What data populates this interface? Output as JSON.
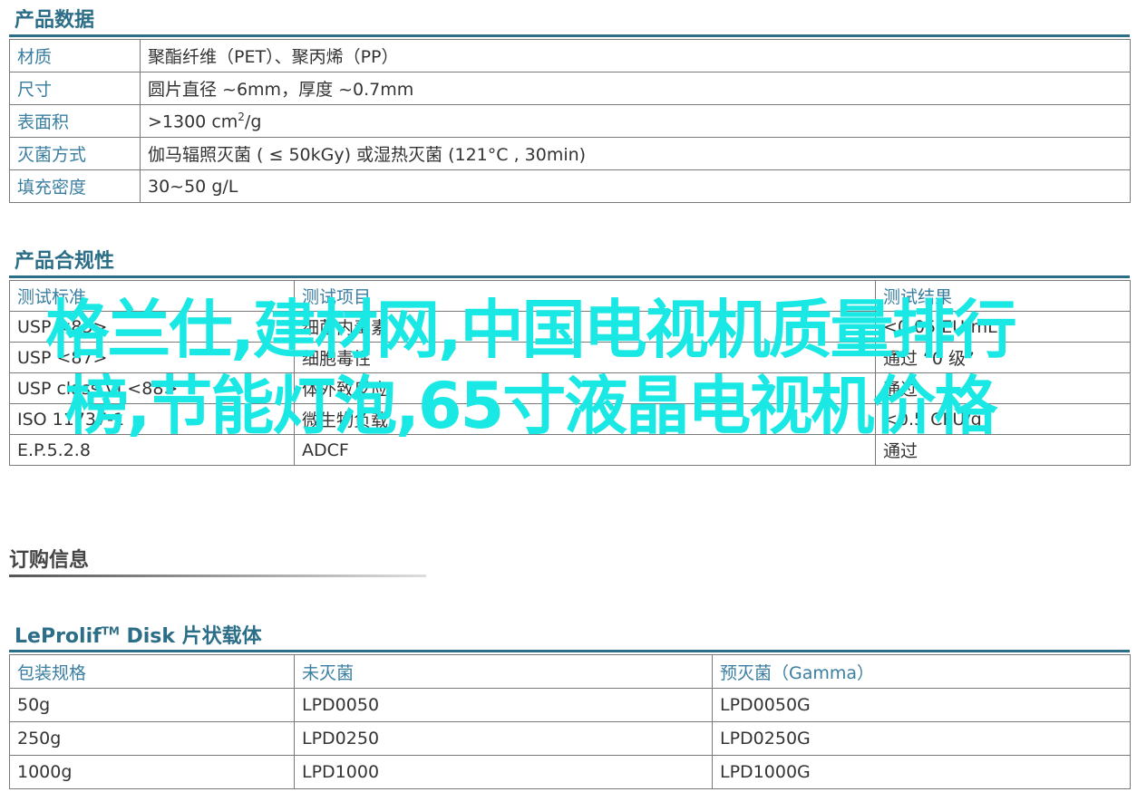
{
  "product_data": {
    "title": "产品数据",
    "rows": [
      {
        "label": "材质",
        "value": "聚酯纤维（PET）、聚丙烯（PP）"
      },
      {
        "label": "尺寸",
        "value": "圆片直径 ~6mm，厚度 ~0.7mm"
      },
      {
        "label": "表面积",
        "value_prefix": ">1300 cm",
        "value_sup": "2",
        "value_suffix": "/g"
      },
      {
        "label": "灭菌方式",
        "value": "伽马辐照灭菌 ( ≤ 50kGy) 或湿热灭菌 (121°C , 30min)"
      },
      {
        "label": "填充密度",
        "value": "30~50 g/L"
      }
    ]
  },
  "compliance": {
    "title": "产品合规性",
    "headers": [
      "测试标准",
      "测试项目",
      "测试结果"
    ],
    "rows": [
      [
        "USP <85>",
        "细菌内毒素",
        "<0.05 EU/mL"
      ],
      [
        "USP <87>",
        "细胞毒性",
        "通过 “0 级”"
      ],
      [
        "USP class VI <88>",
        "体外致反应",
        "通过"
      ],
      [
        "ISO 11737-1",
        "微生物负载",
        "<0.5 CFU/g"
      ],
      [
        "E.P.5.2.8",
        "ADCF",
        "通过"
      ]
    ]
  },
  "order": {
    "title": "订购信息"
  },
  "lerolif": {
    "title_brand": "LeProlif",
    "title_tm": "TM",
    "title_rest": " Disk 片状载体",
    "headers": [
      "包装规格",
      "未灭菌",
      "预灭菌（Gamma）"
    ],
    "rows": [
      [
        "50g",
        "LPD0050",
        "LPD0050G"
      ],
      [
        "250g",
        "LPD0250",
        "LPD0250G"
      ],
      [
        "1000g",
        "LPD1000",
        "LPD1000G"
      ]
    ]
  },
  "watermark": {
    "text": "格兰仕,建材网,中国电视机质量排行榜,节能灯泡,65寸液晶电视机价格"
  },
  "colors": {
    "accent": "#2c6e87",
    "label": "#3a7ea0",
    "watermark": "#1ae8e4"
  }
}
